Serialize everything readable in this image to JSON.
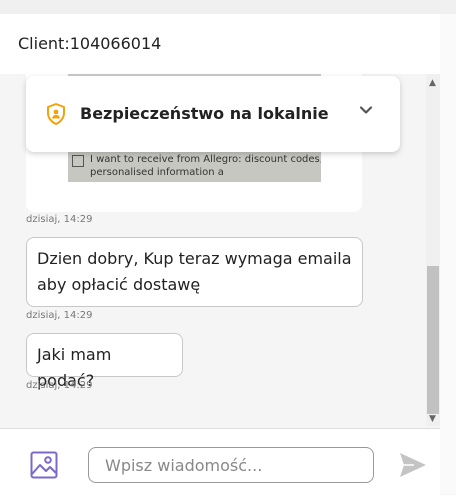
{
  "header": {
    "title": "Client:104066014"
  },
  "security_banner": {
    "title": "Bezpieczeństwo na lokalnie"
  },
  "messages": [
    {
      "kind": "image",
      "photo_line1": "I want to receive from Allegro: discount codes,",
      "photo_line2": "personalised information a",
      "time": "dzisiaj, 14:29"
    },
    {
      "kind": "text",
      "text": "Dzien dobry, Kup teraz wymaga emaila aby opłacić dostawę",
      "time": "dzisiaj, 14:29"
    },
    {
      "kind": "text",
      "text": "Jaki mam podać?",
      "time": "dzisiaj, 14:29"
    }
  ],
  "composer": {
    "placeholder": "Wpisz wiadomość..."
  },
  "icons": {
    "security": "shield-user-icon",
    "expand": "chevron-down-icon",
    "attach": "image-icon",
    "send": "send-icon"
  },
  "colors": {
    "shield": "#f0a30a",
    "image_icon": "#7b68c8",
    "send_icon": "#c4c4c4"
  }
}
